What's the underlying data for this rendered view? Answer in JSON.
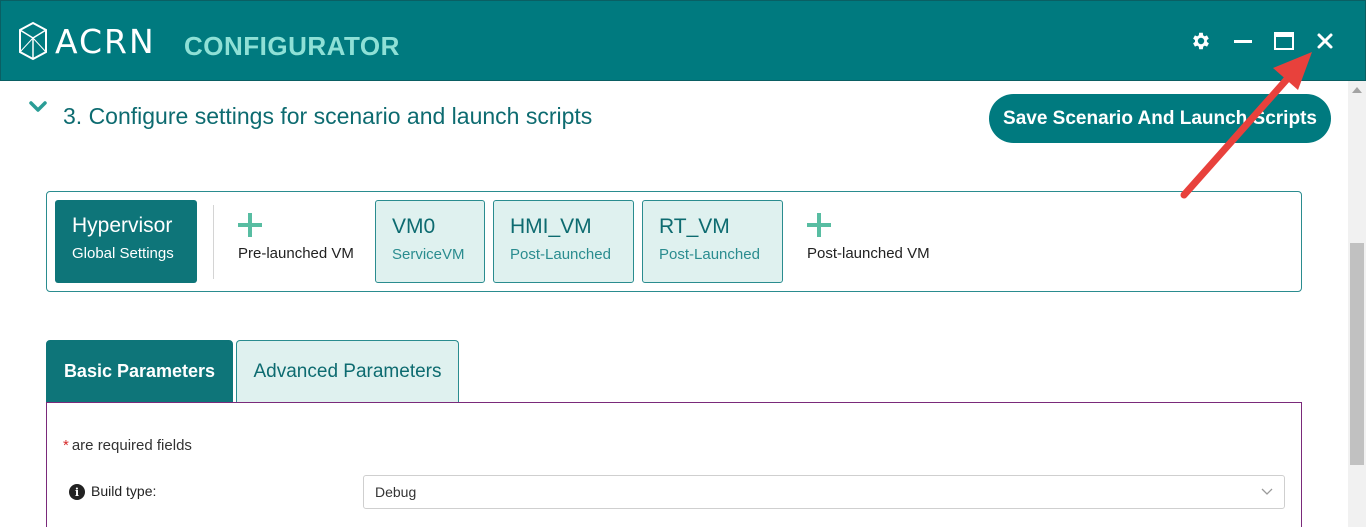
{
  "window": {
    "brand": "ACRN",
    "product": "CONFIGURATOR",
    "icons": [
      "gear-icon",
      "minimize-icon",
      "maximize-icon",
      "close-icon"
    ]
  },
  "section": {
    "title": "3. Configure settings for scenario and launch scripts",
    "save_button": "Save Scenario And Launch Scripts"
  },
  "vm_bar": {
    "hypervisor": {
      "title": "Hypervisor",
      "subtitle": "Global Settings"
    },
    "add_pre_launched": "Pre-launched VM",
    "vms": [
      {
        "name": "VM0",
        "type": "ServiceVM"
      },
      {
        "name": "HMI_VM",
        "type": "Post-Launched"
      },
      {
        "name": "RT_VM",
        "type": "Post-Launched"
      }
    ],
    "add_post_launched": "Post-launched VM"
  },
  "tabs": [
    {
      "label": "Basic Parameters",
      "active": true
    },
    {
      "label": "Advanced Parameters",
      "active": false
    }
  ],
  "form": {
    "required_star": "*",
    "required_note": "are required fields",
    "build_type_label": "Build type:",
    "build_type_value": "Debug"
  },
  "colors": {
    "titlebar": "#007a7f",
    "accent": "#0e7579",
    "brand_accent": "#8ee0d6",
    "vm_card_bg": "#dff1ef",
    "annotation_arrow": "#e8413c"
  }
}
